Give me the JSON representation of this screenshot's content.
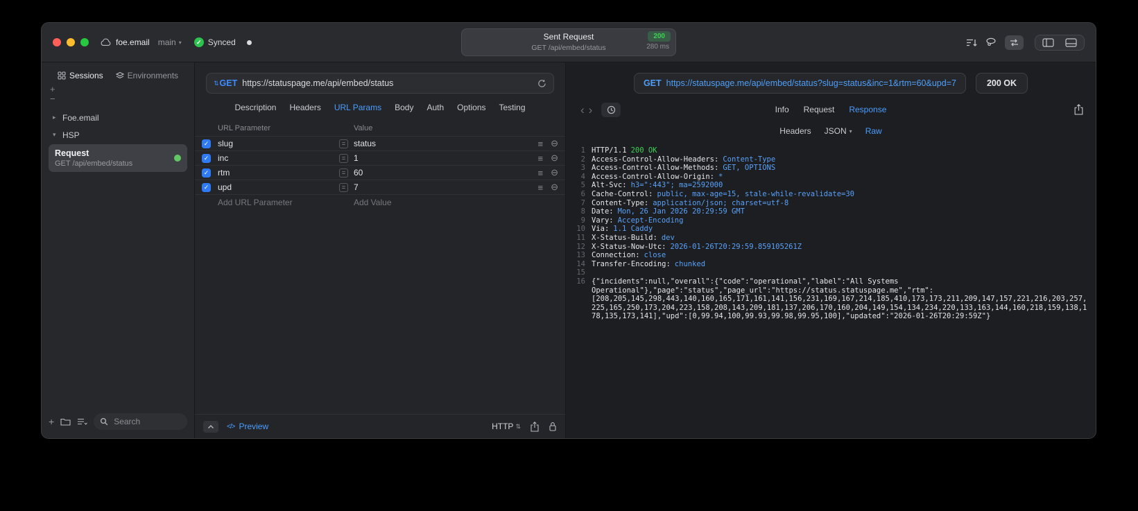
{
  "titlebar": {
    "project": "foe.email",
    "branch": "main",
    "synced": "Synced",
    "request_title": "Sent Request",
    "status_badge": "200",
    "request_subtitle": "GET /api/embed/status",
    "duration": "280 ms"
  },
  "sidebar": {
    "tab_sessions": "Sessions",
    "tab_environments": "Environments",
    "group_foe": "Foe.email",
    "group_hsp": "HSP",
    "request_item": {
      "title": "Request",
      "subtitle": "GET /api/embed/status"
    },
    "search_placeholder": "Search"
  },
  "request_editor": {
    "method": "GET",
    "url": "https://statuspage.me/api/embed/status",
    "tabs": {
      "description": "Description",
      "headers": "Headers",
      "url_params": "URL Params",
      "body": "Body",
      "auth": "Auth",
      "options": "Options",
      "testing": "Testing"
    },
    "param_table": {
      "col_parameter": "URL Parameter",
      "col_value": "Value",
      "rows": [
        {
          "name": "slug",
          "value": "status"
        },
        {
          "name": "inc",
          "value": "1"
        },
        {
          "name": "rtm",
          "value": "60"
        },
        {
          "name": "upd",
          "value": "7"
        }
      ],
      "add_parameter": "Add URL Parameter",
      "add_value": "Add Value"
    },
    "footer": {
      "preview": "Preview",
      "protocol": "HTTP"
    }
  },
  "response_viewer": {
    "method": "GET",
    "url": "https://statuspage.me/api/embed/status?slug=status&inc=1&rtm=60&upd=7",
    "status": "200 OK",
    "tabs": {
      "info": "Info",
      "request": "Request",
      "response": "Response"
    },
    "subtabs": {
      "headers": "Headers",
      "json": "JSON",
      "raw": "Raw"
    },
    "lines": [
      {
        "n": "1",
        "key": "HTTP/1.1",
        "value": "200 OK"
      },
      {
        "n": "2",
        "key": "Access-Control-Allow-Headers:",
        "value": "Content-Type"
      },
      {
        "n": "3",
        "key": "Access-Control-Allow-Methods:",
        "value": "GET, OPTIONS"
      },
      {
        "n": "4",
        "key": "Access-Control-Allow-Origin:",
        "value": "*"
      },
      {
        "n": "5",
        "key": "Alt-Svc:",
        "value": "h3=\":443\"; ma=2592000"
      },
      {
        "n": "6",
        "key": "Cache-Control:",
        "value": "public, max-age=15, stale-while-revalidate=30"
      },
      {
        "n": "7",
        "key": "Content-Type:",
        "value": "application/json; charset=utf-8"
      },
      {
        "n": "8",
        "key": "Date:",
        "value": "Mon, 26 Jan 2026 20:29:59 GMT"
      },
      {
        "n": "9",
        "key": "Vary:",
        "value": "Accept-Encoding"
      },
      {
        "n": "10",
        "key": "Via:",
        "value": "1.1 Caddy"
      },
      {
        "n": "11",
        "key": "X-Status-Build:",
        "value": "dev"
      },
      {
        "n": "12",
        "key": "X-Status-Now-Utc:",
        "value": "2026-01-26T20:29:59.859105261Z"
      },
      {
        "n": "13",
        "key": "Connection:",
        "value": "close"
      },
      {
        "n": "14",
        "key": "Transfer-Encoding:",
        "value": "chunked"
      },
      {
        "n": "15",
        "key": "",
        "value": ""
      },
      {
        "n": "16",
        "body": "{\"incidents\":null,\"overall\":{\"code\":\"operational\",\"label\":\"All Systems Operational\"},\"page\":\"status\",\"page_url\":\"https://status.statuspage.me\",\"rtm\":[208,205,145,298,443,140,160,165,171,161,141,156,231,169,167,214,185,410,173,173,211,209,147,157,221,216,203,257,225,165,250,173,204,223,158,208,143,209,181,137,206,170,160,204,149,154,134,234,220,133,163,144,160,218,159,138,178,135,173,141],\"upd\":[0,99.94,100,99.93,99.98,99.95,100],\"updated\":\"2026-01-26T20:29:59Z\"}"
      }
    ]
  },
  "glyphs": {
    "check": "✓",
    "plus": "+",
    "minus": "−",
    "drag_handle": "≡",
    "remove": "⊖",
    "equals": "=",
    "updown": "⇅",
    "caret_down": "▾",
    "caret_right": "▸",
    "back": "‹",
    "forward": "›",
    "code": "</>"
  }
}
